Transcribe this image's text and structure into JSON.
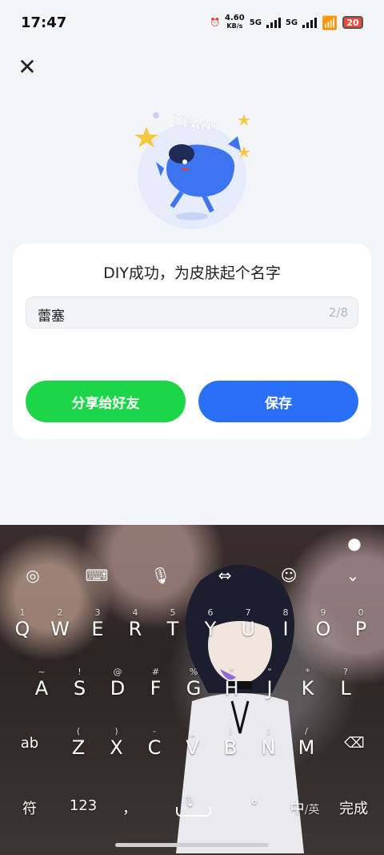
{
  "status": {
    "time": "17:47",
    "net_speed": "4.60",
    "net_unit": "KB/s",
    "sim1": "5G",
    "sim2": "5G",
    "battery": "20"
  },
  "mascot": {
    "text": "YEAH!"
  },
  "dialog": {
    "title": "DIY成功，为皮肤起个名字",
    "name_value": "蕾塞",
    "counter": "2/8",
    "share_label": "分享给好友",
    "save_label": "保存"
  },
  "keyboard": {
    "row1": [
      {
        "k": "Q",
        "s": "1"
      },
      {
        "k": "W",
        "s": "2"
      },
      {
        "k": "E",
        "s": "3"
      },
      {
        "k": "R",
        "s": "4"
      },
      {
        "k": "T",
        "s": "5"
      },
      {
        "k": "Y",
        "s": "6"
      },
      {
        "k": "U",
        "s": "7"
      },
      {
        "k": "I",
        "s": "8"
      },
      {
        "k": "O",
        "s": "9"
      },
      {
        "k": "P",
        "s": "0"
      }
    ],
    "row2": [
      {
        "k": "A",
        "s": "~"
      },
      {
        "k": "S",
        "s": "!"
      },
      {
        "k": "D",
        "s": "@"
      },
      {
        "k": "F",
        "s": "#"
      },
      {
        "k": "G",
        "s": "%"
      },
      {
        "k": "H",
        "s": "\""
      },
      {
        "k": "J",
        "s": "\""
      },
      {
        "k": "K",
        "s": "*"
      },
      {
        "k": "L",
        "s": "?"
      }
    ],
    "row3": [
      {
        "k": "Z",
        "s": "("
      },
      {
        "k": "X",
        "s": ")"
      },
      {
        "k": "C",
        "s": "-"
      },
      {
        "k": "V",
        "s": "_"
      },
      {
        "k": "B",
        "s": ":"
      },
      {
        "k": "N",
        "s": ";"
      },
      {
        "k": "M",
        "s": "/"
      }
    ],
    "ab": "ab",
    "fu": "符",
    "num": "123",
    "comma": "，",
    "lang_zh": "中",
    "lang_en": "/英",
    "done": "完成"
  }
}
